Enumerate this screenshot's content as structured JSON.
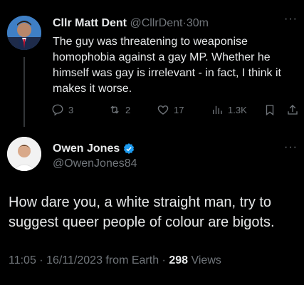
{
  "reply": {
    "author_name": "Cllr Matt Dent",
    "handle": "@CllrDent",
    "separator": "·",
    "time_ago": "30m",
    "text": "The guy was threatening to weaponise homophobia against a gay MP. Whether he himself was gay is irrelevant - in fact, I think it makes it worse.",
    "more_label": "···",
    "actions": {
      "replies": "3",
      "reposts": "2",
      "likes": "17",
      "views": "1.3K"
    }
  },
  "main_tweet": {
    "author_name": "Owen Jones",
    "handle": "@OwenJones84",
    "more_label": "···",
    "text": "How dare you, a white straight man, try to suggest queer people of colour are bigots.",
    "timestamp": "11:05 · 16/11/2023 from Earth ·",
    "views_count": "298",
    "views_label": "Views"
  },
  "colors": {
    "background": "#000000",
    "text": "#e7e9ea",
    "muted": "#71767b",
    "verified": "#1d9bf0"
  },
  "icons": [
    "reply-icon",
    "repost-icon",
    "like-icon",
    "views-icon",
    "bookmark-icon",
    "share-icon",
    "verified-badge-icon",
    "more-icon"
  ]
}
